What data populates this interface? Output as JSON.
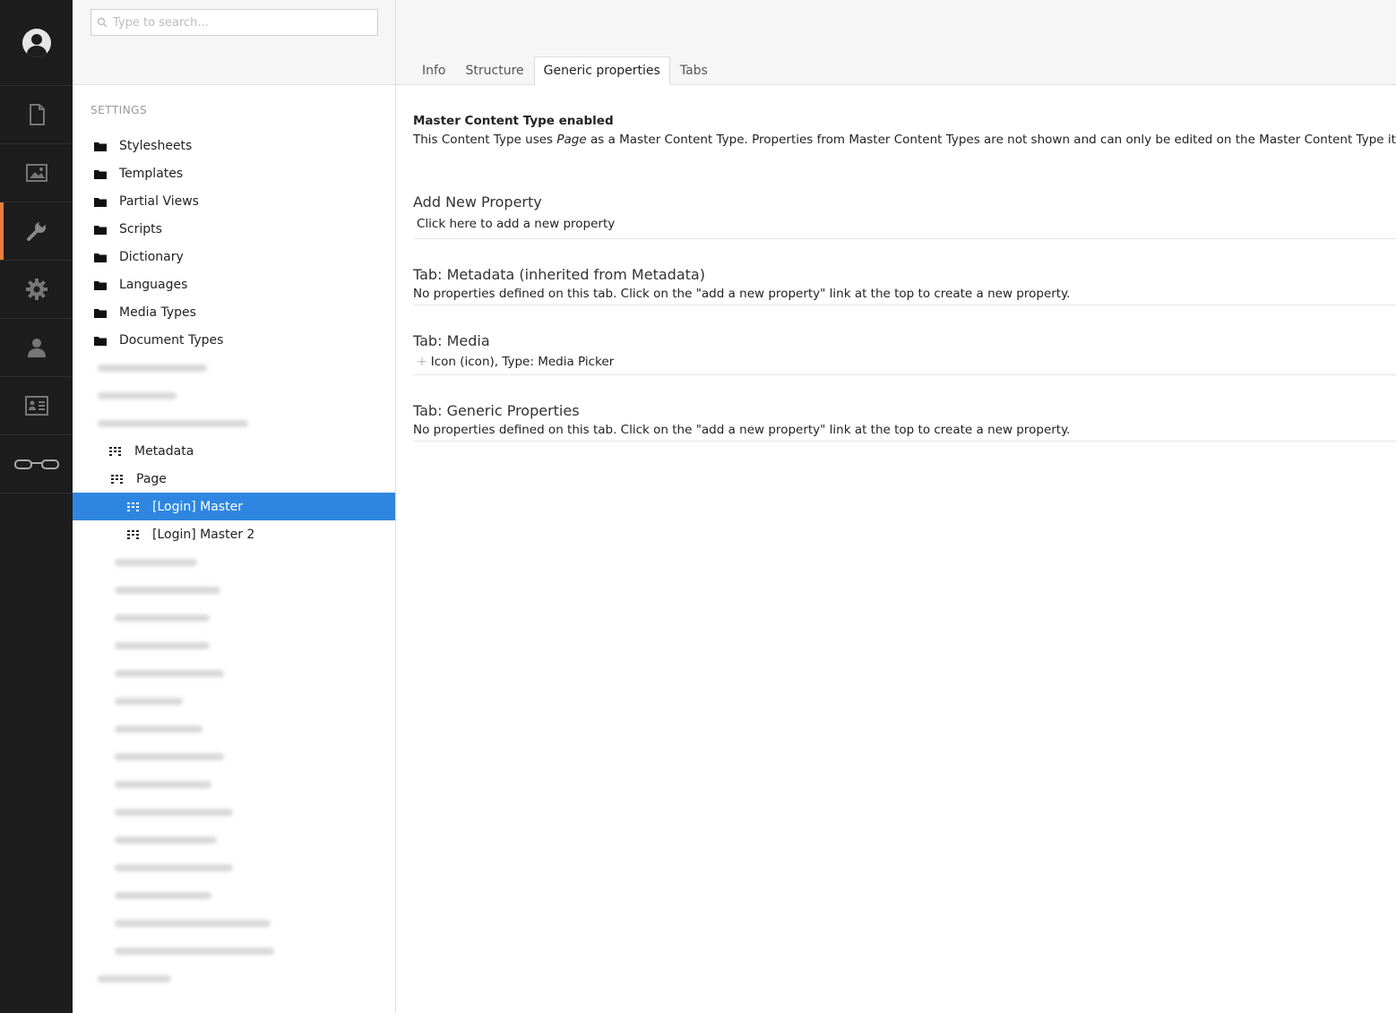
{
  "search": {
    "placeholder": "Type to search..."
  },
  "tree": {
    "section_title": "SETTINGS",
    "folders": [
      {
        "label": "Stylesheets"
      },
      {
        "label": "Templates"
      },
      {
        "label": "Partial Views"
      },
      {
        "label": "Scripts"
      },
      {
        "label": "Dictionary"
      },
      {
        "label": "Languages"
      },
      {
        "label": "Media Types"
      },
      {
        "label": "Document Types"
      }
    ],
    "doc_types": {
      "metadata": "Metadata",
      "page": "Page",
      "login_master": "[Login] Master",
      "login_master_2": "[Login] Master 2"
    }
  },
  "tabs": [
    {
      "label": "Info"
    },
    {
      "label": "Structure"
    },
    {
      "label": "Generic properties"
    },
    {
      "label": "Tabs"
    }
  ],
  "content": {
    "master_title": "Master Content Type enabled",
    "master_text_before": "This Content Type uses ",
    "master_text_em": "Page",
    "master_text_after": " as a Master Content Type. Properties from Master Content Types are not shown and can only be edited on the Master Content Type itself",
    "add_title": "Add New Property",
    "add_link": "Click here to add a new property",
    "tab_metadata_title": "Tab: Metadata (inherited from Metadata)",
    "tab_metadata_text": "No properties defined on this tab. Click on the \"add a new property\" link at the top to create a new property.",
    "tab_media_title": "Tab: Media",
    "tab_media_prop": "Icon (icon), Type: Media Picker",
    "tab_generic_title": "Tab: Generic Properties",
    "tab_generic_text": "No properties defined on this tab. Click on the \"add a new property\" link at the top to create a new property."
  },
  "colors": {
    "rail_bg": "#1d1d1d",
    "rail_active": "#e87e3c",
    "selection": "#2f86e0"
  }
}
